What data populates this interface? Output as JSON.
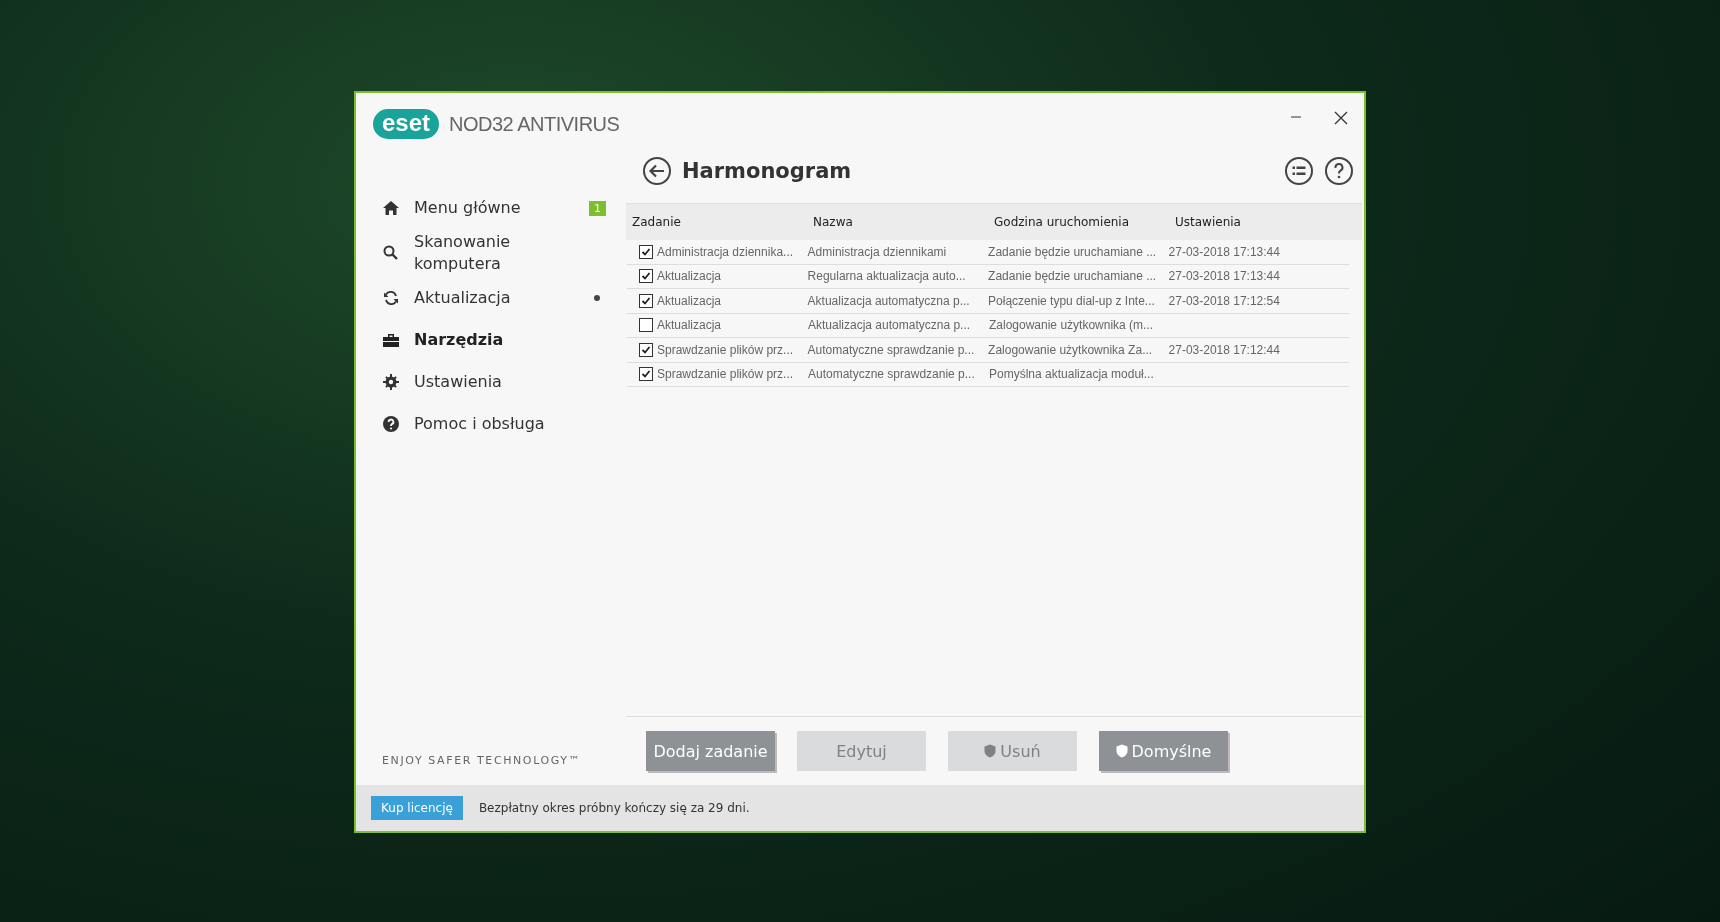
{
  "window": {
    "logo": "eset",
    "product": "NOD32 ANTIVIRUS"
  },
  "sidebar": {
    "items": [
      {
        "label": "Menu główne",
        "badge": "1",
        "dot": false,
        "selected": false
      },
      {
        "label": "Skanowanie komputera",
        "dot": false,
        "selected": false
      },
      {
        "label": "Aktualizacja",
        "dot": true,
        "selected": false
      },
      {
        "label": "Narzędzia",
        "dot": false,
        "selected": true
      },
      {
        "label": "Ustawienia",
        "dot": false,
        "selected": false
      },
      {
        "label": "Pomoc i obsługa",
        "dot": false,
        "selected": false
      }
    ],
    "tagline": "ENJOY SAFER TECHNOLOGY™"
  },
  "page": {
    "title": "Harmonogram"
  },
  "table": {
    "columns": [
      "Zadanie",
      "Nazwa",
      "Godzina uruchomienia",
      "Ustawienia"
    ],
    "rows": [
      {
        "checked": true,
        "cells": [
          "Administracja dziennika...",
          "Administracja dziennikami",
          "Zadanie będzie uruchamiane ...",
          "27-03-2018 17:13:44"
        ]
      },
      {
        "checked": true,
        "cells": [
          "Aktualizacja",
          "Regularna aktualizacja auto...",
          "Zadanie będzie uruchamiane ...",
          "27-03-2018 17:13:44"
        ]
      },
      {
        "checked": true,
        "cells": [
          "Aktualizacja",
          "Aktualizacja automatyczna p...",
          "Połączenie typu dial-up z Inte...",
          "27-03-2018 17:12:54"
        ]
      },
      {
        "checked": false,
        "cells": [
          "Aktualizacja",
          "Aktualizacja automatyczna p...",
          "Zalogowanie użytkownika (m..."
        ]
      },
      {
        "checked": true,
        "cells": [
          "Sprawdzanie plików prz...",
          "Automatyczne sprawdzanie p...",
          "Zalogowanie użytkownika Za...",
          "27-03-2018 17:12:44"
        ]
      },
      {
        "checked": true,
        "cells": [
          "Sprawdzanie plików prz...",
          "Automatyczne sprawdzanie p...",
          "Pomyślna aktualizacja moduł..."
        ]
      }
    ]
  },
  "buttons": [
    {
      "label": "Dodaj zadanie",
      "disabled": false,
      "shield": false
    },
    {
      "label": "Edytuj",
      "disabled": true,
      "shield": false
    },
    {
      "label": "Usuń",
      "disabled": true,
      "shield": true
    },
    {
      "label": "Domyślne",
      "disabled": false,
      "shield": true
    }
  ],
  "status_bar": {
    "button": "Kup licencję",
    "message": "Bezpłatny okres próbny kończy się za 29 dni."
  }
}
